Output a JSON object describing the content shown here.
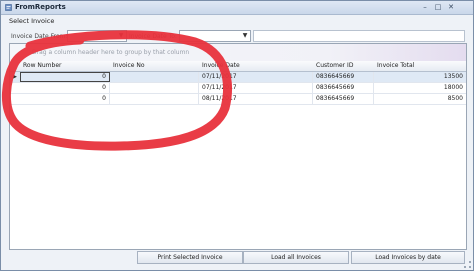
{
  "window": {
    "title": "FromReports",
    "minimize_glyph": "–",
    "maximize_glyph": "□",
    "close_glyph": "✕"
  },
  "section_label": "Select Invoice",
  "filters": {
    "from_label": "Invoice Date From:",
    "to_label": "Invoice Date To:"
  },
  "grid": {
    "group_hint": "Drag a column header here to group by that column",
    "columns": [
      "Row Number",
      "Invoice No",
      "Invoice Date",
      "Customer ID",
      "Invoice Total"
    ],
    "rows": [
      {
        "row_number": "0",
        "invoice_no": "",
        "invoice_date": "07/11/2017",
        "customer_id": "0836645669",
        "invoice_total": "13500",
        "selected": true
      },
      {
        "row_number": "0",
        "invoice_no": "",
        "invoice_date": "07/11/2017",
        "customer_id": "0836645669",
        "invoice_total": "18000",
        "selected": false
      },
      {
        "row_number": "0",
        "invoice_no": "",
        "invoice_date": "08/11/2017",
        "customer_id": "0836645669",
        "invoice_total": "8500",
        "selected": false
      }
    ]
  },
  "buttons": {
    "print_selected": "Print Selected Invoice",
    "load_all": "Load all Invoices",
    "load_by_date": "Load Invoices by date"
  },
  "colors": {
    "annotation": "#e8323c",
    "selected_row": "#dfe9f5"
  },
  "icons": {
    "app": "app-icon",
    "row_indicator": "current-row-arrow"
  }
}
